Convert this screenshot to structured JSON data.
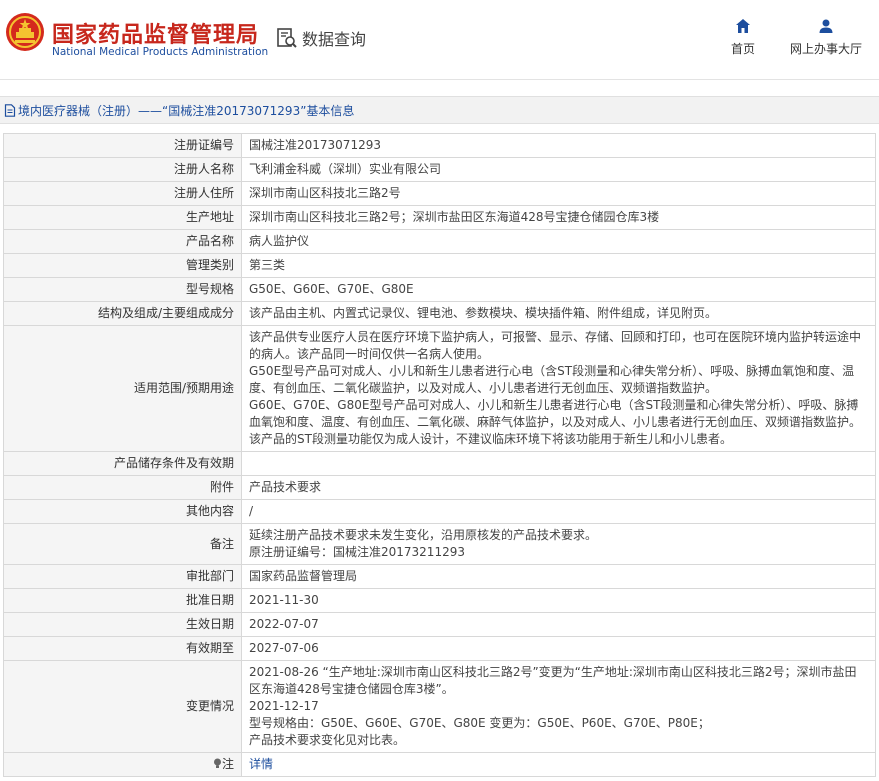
{
  "header": {
    "brand_cn": "国家药品监督管理局",
    "brand_en": "National Medical Products Administration",
    "query_label": "数据查询",
    "nav_home": "首页",
    "nav_service_hall": "网上办事大厅",
    "brand_color": "#c7271c",
    "link_color": "#1d4e9e"
  },
  "breadcrumb": {
    "text": "境内医疗器械（注册）——“国械注准20173071293”基本信息"
  },
  "fields": [
    {
      "label": "注册证编号",
      "lines": [
        "国械注准20173071293"
      ]
    },
    {
      "label": "注册人名称",
      "lines": [
        "飞利浦金科威（深圳）实业有限公司"
      ]
    },
    {
      "label": "注册人住所",
      "lines": [
        "深圳市南山区科技北三路2号"
      ]
    },
    {
      "label": "生产地址",
      "lines": [
        "深圳市南山区科技北三路2号；深圳市盐田区东海道428号宝捷仓储园仓库3楼"
      ]
    },
    {
      "label": "产品名称",
      "lines": [
        "病人监护仪"
      ]
    },
    {
      "label": "管理类别",
      "lines": [
        "第三类"
      ]
    },
    {
      "label": "型号规格",
      "lines": [
        "G50E、G60E、G70E、G80E"
      ]
    },
    {
      "label": "结构及组成/主要组成成分",
      "lines": [
        "该产品由主机、内置式记录仪、锂电池、参数模块、模块插件箱、附件组成，详见附页。"
      ]
    },
    {
      "label": "适用范围/预期用途",
      "lines": [
        "该产品供专业医疗人员在医疗环境下监护病人，可报警、显示、存储、回顾和打印，也可在医院环境内监护转运途中的病人。该产品同一时间仅供一名病人使用。",
        "G50E型号产品可对成人、小儿和新生儿患者进行心电（含ST段测量和心律失常分析）、呼吸、脉搏血氧饱和度、温度、有创血压、二氧化碳监护，以及对成人、小儿患者进行无创血压、双频谱指数监护。",
        "G60E、G70E、G80E型号产品可对成人、小儿和新生儿患者进行心电（含ST段测量和心律失常分析）、呼吸、脉搏血氧饱和度、温度、有创血压、二氧化碳、麻醉气体监护，以及对成人、小儿患者进行无创血压、双频谱指数监护。",
        "该产品的ST段测量功能仅为成人设计，不建议临床环境下将该功能用于新生儿和小儿患者。"
      ]
    },
    {
      "label": "产品储存条件及有效期",
      "lines": [
        ""
      ]
    },
    {
      "label": "附件",
      "lines": [
        "产品技术要求"
      ]
    },
    {
      "label": "其他内容",
      "lines": [
        "/"
      ]
    },
    {
      "label": "备注",
      "lines": [
        "延续注册产品技术要求未发生变化，沿用原核发的产品技术要求。",
        "原注册证编号：国械注准20173211293"
      ]
    },
    {
      "label": "审批部门",
      "lines": [
        "国家药品监督管理局"
      ]
    },
    {
      "label": "批准日期",
      "lines": [
        "2021-11-30"
      ]
    },
    {
      "label": "生效日期",
      "lines": [
        "2022-07-07"
      ]
    },
    {
      "label": "有效期至",
      "lines": [
        "2027-07-06"
      ]
    },
    {
      "label": "变更情况",
      "lines": [
        "2021-08-26 “生产地址:深圳市南山区科技北三路2号”变更为“生产地址:深圳市南山区科技北三路2号；深圳市盐田区东海道428号宝捷仓储园仓库3楼”。",
        "2021-12-17",
        "型号规格由：G50E、G60E、G70E、G80E 变更为：G50E、P60E、G70E、P80E；",
        "产品技术要求变化见对比表。"
      ]
    }
  ],
  "note": {
    "label": "注",
    "link": "详情"
  }
}
